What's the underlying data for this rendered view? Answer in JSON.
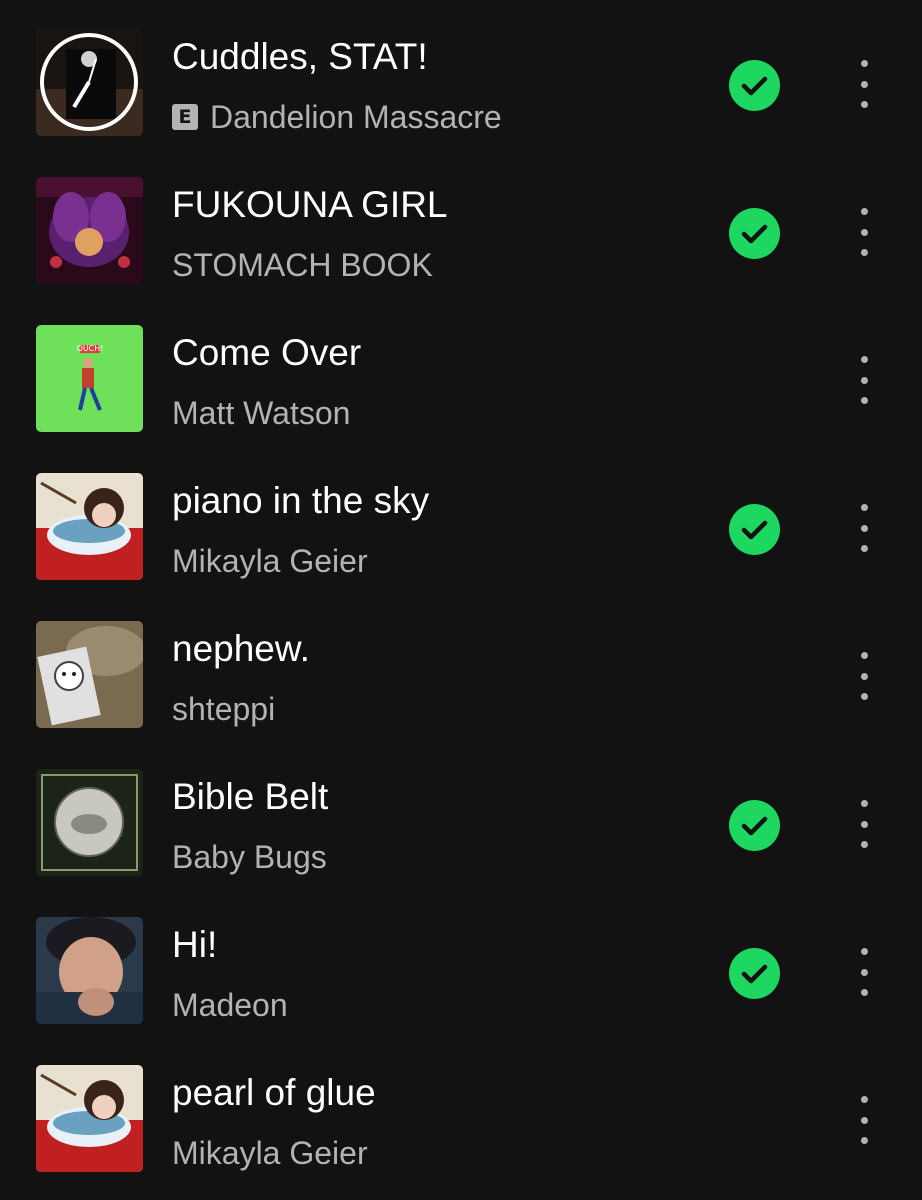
{
  "tracks": [
    {
      "title": "Cuddles, STAT!",
      "artist": "Dandelion Massacre",
      "explicit": true,
      "explicit_label": "E",
      "downloaded": true,
      "cover_icon": "album-art-cuddles-stat"
    },
    {
      "title": "FUKOUNA GIRL",
      "artist": "STOMACH BOOK",
      "explicit": false,
      "downloaded": true,
      "cover_icon": "album-art-fukouna-girl"
    },
    {
      "title": "Come Over",
      "artist": "Matt Watson",
      "explicit": false,
      "downloaded": false,
      "cover_icon": "album-art-come-over",
      "cover_text": "OUCH!"
    },
    {
      "title": "piano in the sky",
      "artist": "Mikayla Geier",
      "explicit": false,
      "downloaded": true,
      "cover_icon": "album-art-piano-in-the-sky"
    },
    {
      "title": "nephew.",
      "artist": "shteppi",
      "explicit": false,
      "downloaded": false,
      "cover_icon": "album-art-nephew"
    },
    {
      "title": "Bible Belt",
      "artist": "Baby Bugs",
      "explicit": false,
      "downloaded": true,
      "cover_icon": "album-art-bible-belt"
    },
    {
      "title": "Hi!",
      "artist": "Madeon",
      "explicit": false,
      "downloaded": true,
      "cover_icon": "album-art-hi"
    },
    {
      "title": "pearl of glue",
      "artist": "Mikayla Geier",
      "explicit": false,
      "downloaded": false,
      "cover_icon": "album-art-pearl-of-glue"
    }
  ],
  "colors": {
    "background": "#121212",
    "title": "#ffffff",
    "secondary": "#b3b3b3",
    "downloaded_green": "#1ed760"
  }
}
